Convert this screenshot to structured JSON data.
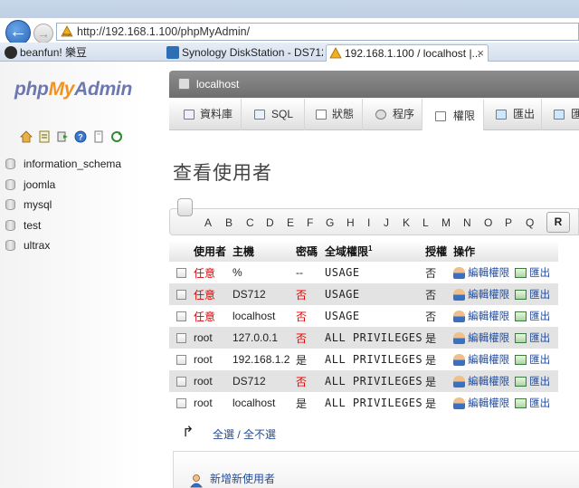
{
  "browser": {
    "address_url": "http://192.168.1.100/phpMyAdmin/",
    "tabs": [
      {
        "label": "beanfun! 樂豆"
      },
      {
        "label": "Synology DiskStation - DS712"
      },
      {
        "label": "192.168.1.100 / localhost |..."
      }
    ],
    "close_glyph": "×",
    "back_glyph": "←",
    "fwd_glyph": "→"
  },
  "sidebar": {
    "logo": {
      "php": "php",
      "my": "My",
      "admin": "Admin"
    },
    "databases": [
      "information_schema",
      "joomla",
      "mysql",
      "test",
      "ultrax"
    ]
  },
  "header": {
    "server": "localhost"
  },
  "menu": [
    {
      "label": "資料庫",
      "icon": "database-icon"
    },
    {
      "label": "SQL",
      "icon": "sql-icon"
    },
    {
      "label": "狀態",
      "icon": "status-icon"
    },
    {
      "label": "程序",
      "icon": "process-icon"
    },
    {
      "label": "權限",
      "icon": "privileges-icon"
    },
    {
      "label": "匯出",
      "icon": "export-icon"
    },
    {
      "label": "匯",
      "icon": "import-icon"
    }
  ],
  "page_title": "查看使用者",
  "alphabet": [
    "A",
    "B",
    "C",
    "D",
    "E",
    "F",
    "G",
    "H",
    "I",
    "J",
    "K",
    "L",
    "M",
    "N",
    "O",
    "P",
    "Q",
    "R"
  ],
  "table": {
    "headers": {
      "user": "使用者",
      "host": "主機",
      "password": "密碼",
      "global_priv": "全域權限",
      "global_priv_sup": "1",
      "grant": "授權",
      "action": "操作"
    },
    "edit_label": "編輯權限",
    "export_label": "匯出",
    "rows": [
      {
        "user": "任意",
        "user_red": true,
        "host": "%",
        "password": "--",
        "password_red": false,
        "priv": "USAGE",
        "grant": "否"
      },
      {
        "user": "任意",
        "user_red": true,
        "host": "DS712",
        "password": "否",
        "password_red": true,
        "priv": "USAGE",
        "grant": "否"
      },
      {
        "user": "任意",
        "user_red": true,
        "host": "localhost",
        "password": "否",
        "password_red": true,
        "priv": "USAGE",
        "grant": "否"
      },
      {
        "user": "root",
        "user_red": false,
        "host": "127.0.0.1",
        "password": "否",
        "password_red": true,
        "priv": "ALL PRIVILEGES",
        "grant": "是"
      },
      {
        "user": "root",
        "user_red": false,
        "host": "192.168.1.2",
        "password": "是",
        "password_red": false,
        "priv": "ALL PRIVILEGES",
        "grant": "是"
      },
      {
        "user": "root",
        "user_red": false,
        "host": "DS712",
        "password": "否",
        "password_red": true,
        "priv": "ALL PRIVILEGES",
        "grant": "是"
      },
      {
        "user": "root",
        "user_red": false,
        "host": "localhost",
        "password": "是",
        "password_red": false,
        "priv": "ALL PRIVILEGES",
        "grant": "是"
      }
    ]
  },
  "select_all": "全選 / 全不選",
  "select_arrow": "↱",
  "add_user": "新增新使用者",
  "colors": {
    "red": "#dd0000",
    "link": "#234c9c",
    "logo_blue": "#6c78af",
    "logo_orange": "#f29222"
  }
}
